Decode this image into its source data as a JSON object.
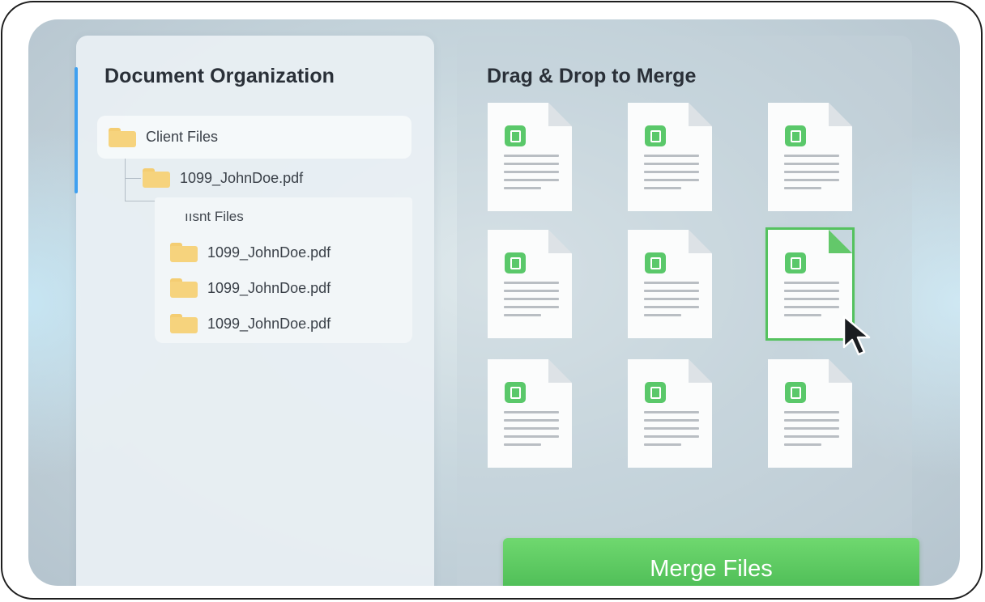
{
  "left_panel": {
    "title": "Document Organization",
    "tree": {
      "root_label": "Client Files",
      "child_label": "1099_JohnDoe.pdf",
      "subgroup_label": "ıısnt Files",
      "subgroup_items": [
        "1099_JohnDoe.pdf",
        "1099_JohnDoe.pdf",
        "1099_JohnDoe.pdf"
      ]
    }
  },
  "right_panel": {
    "title": "Drag & Drop to Merge",
    "documents": [
      {
        "icon": "document-icon",
        "selected": false
      },
      {
        "icon": "document-icon",
        "selected": false
      },
      {
        "icon": "document-icon",
        "selected": false
      },
      {
        "icon": "document-icon",
        "selected": false
      },
      {
        "icon": "document-icon",
        "selected": false
      },
      {
        "icon": "document-icon",
        "selected": true
      },
      {
        "icon": "document-icon",
        "selected": false
      },
      {
        "icon": "document-icon",
        "selected": false
      },
      {
        "icon": "document-icon",
        "selected": false
      }
    ],
    "merge_button_label": "Merge Files"
  },
  "colors": {
    "accent_blue": "#3fa0f0",
    "merge_green": "#55c25f",
    "folder_yellow": "#f6d37d"
  }
}
